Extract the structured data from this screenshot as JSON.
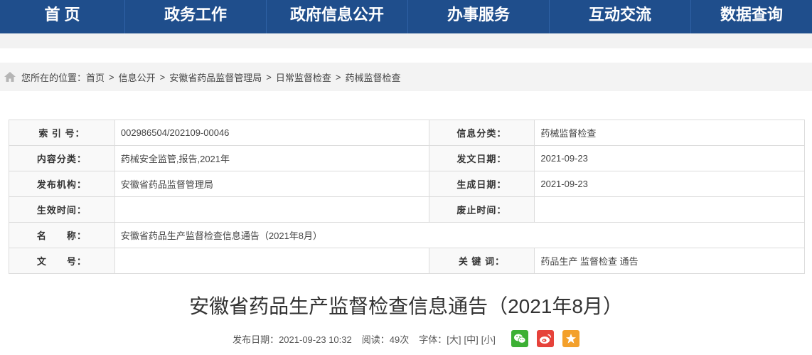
{
  "nav": {
    "items": [
      "首 页",
      "政务工作",
      "政府信息公开",
      "办事服务",
      "互动交流",
      "数据查询"
    ]
  },
  "breadcrumb": {
    "label": "您所在的位置：",
    "items": [
      "首页",
      "信息公开",
      "安徽省药品监督管理局",
      "日常监督检查",
      "药械监督检查"
    ],
    "separator": ">"
  },
  "meta": {
    "index_key": "索 引 号：",
    "index_val": "002986504/202109-00046",
    "category_key": "信息分类：",
    "category_val": "药械监督检查",
    "content_key": "内容分类：",
    "content_val": "药械安全监管,报告,2021年",
    "issue_date_key": "发文日期：",
    "issue_date_val": "2021-09-23",
    "org_key": "发布机构：",
    "org_val": "安徽省药品监督管理局",
    "gen_date_key": "生成日期：",
    "gen_date_val": "2021-09-23",
    "effective_key": "生效时间：",
    "effective_val": "",
    "abolish_key": "废止时间：",
    "abolish_val": "",
    "name_key": "名　　称：",
    "name_val": "安徽省药品生产监督检查信息通告（2021年8月）",
    "doc_no_key": "文　　号：",
    "doc_no_val": "",
    "keywords_key": "关 键 词：",
    "keywords_val": "药品生产 监督检查 通告"
  },
  "article": {
    "title": "安徽省药品生产监督检查信息通告（2021年8月）",
    "publish_label": "发布日期：2021-09-23 10:32",
    "views_label": "阅读：49次",
    "font_label": "字体：",
    "size_large": "[大]",
    "size_medium": "[中]",
    "size_small": "[小]"
  },
  "colors": {
    "nav_bg": "#1f4e8c",
    "wechat": "#3cb034",
    "weibo": "#e6423a",
    "favorite": "#f3a02b"
  },
  "icons": [
    "home-icon",
    "wechat-icon",
    "weibo-icon",
    "star-icon"
  ]
}
